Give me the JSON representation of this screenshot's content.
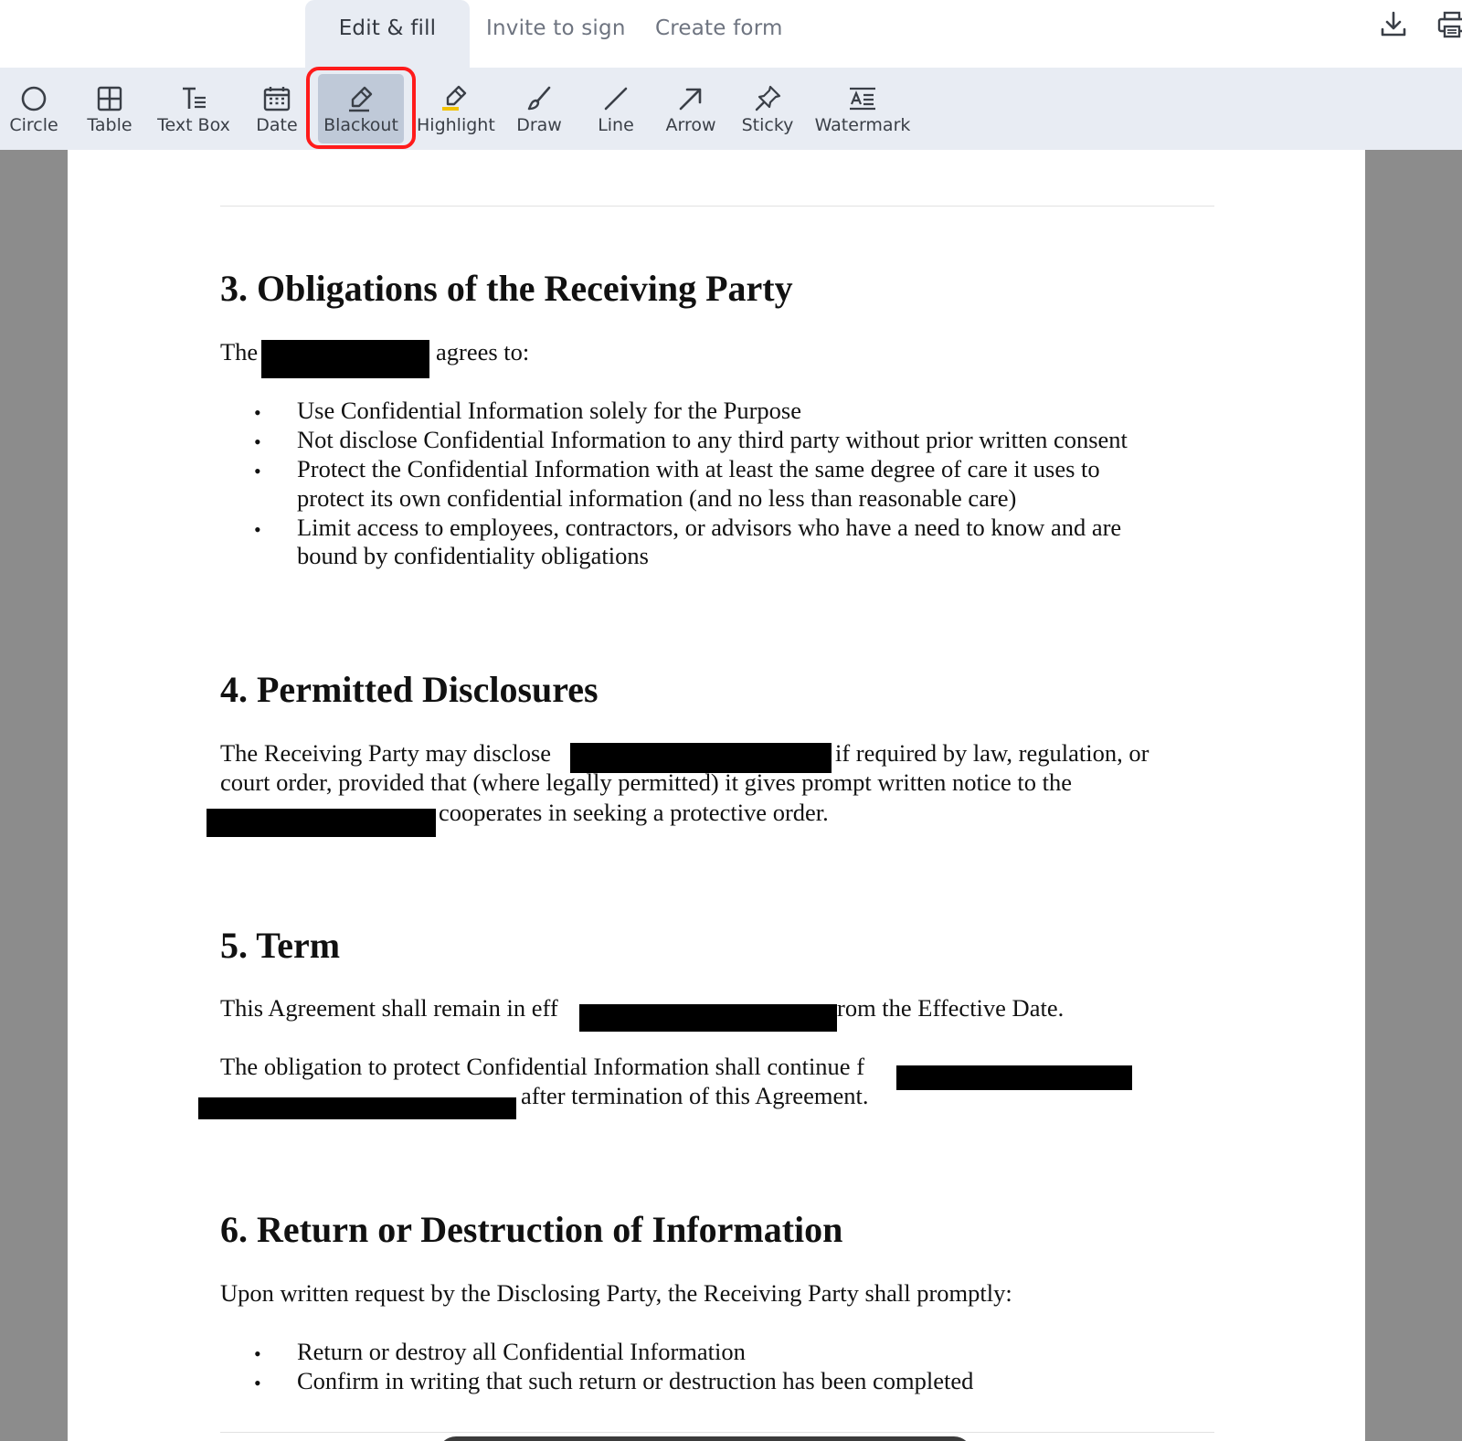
{
  "tabs": [
    {
      "label": "Edit & fill",
      "active": true
    },
    {
      "label": "Invite to sign",
      "active": false
    },
    {
      "label": "Create form",
      "active": false
    }
  ],
  "top_actions": {
    "download_icon": "download-icon",
    "print_icon": "print-icon"
  },
  "toolbar": {
    "tools": [
      {
        "label": "Circle",
        "icon": "circle-icon"
      },
      {
        "label": "Table",
        "icon": "table-icon"
      },
      {
        "label": "Text Box",
        "icon": "text-box-icon"
      },
      {
        "label": "Date",
        "icon": "calendar-icon"
      },
      {
        "label": "Blackout",
        "icon": "blackout-marker-icon",
        "selected": true
      },
      {
        "label": "Highlight",
        "icon": "highlighter-icon"
      },
      {
        "label": "Draw",
        "icon": "brush-icon"
      },
      {
        "label": "Line",
        "icon": "line-icon"
      },
      {
        "label": "Arrow",
        "icon": "arrow-icon"
      },
      {
        "label": "Sticky",
        "icon": "pin-icon"
      },
      {
        "label": "Watermark",
        "icon": "watermark-icon"
      }
    ]
  },
  "document": {
    "s3": {
      "heading": "3. Obligations of the Receiving Party",
      "intro_before": "The",
      "intro_after": "agrees to:",
      "bullets": [
        "Use Confidential Information solely for the Purpose",
        "Not disclose Confidential Information to any third party without prior written consent",
        "Protect the Confidential Information with at least the same degree of care it uses to",
        "protect its own confidential information (and no less than reasonable care)",
        "Limit access to employees, contractors, or advisors who have a need to know and are",
        "bound by confidentiality obligations"
      ]
    },
    "s4": {
      "heading": "4. Permitted Disclosures",
      "line1_before": "The Receiving Party may disclose",
      "line1_after": "if required by law, regulation, or",
      "line2": "court order, provided that (where legally permitted) it gives prompt written notice to the",
      "line3_after": "cooperates in seeking a protective order."
    },
    "s5": {
      "heading": "5. Term",
      "p1_before": "This Agreement shall remain in eff",
      "p1_after": "rom the Effective Date.",
      "p2_before": "The obligation to protect Confidential Information shall continue f",
      "p2_after": "after termination of this Agreement."
    },
    "s6": {
      "heading": "6. Return or Destruction of Information",
      "intro": "Upon written request by the Disclosing Party, the Receiving Party shall promptly:",
      "bullets": [
        "Return or destroy all Confidential Information",
        "Confirm in writing that such return or destruction has been completed"
      ]
    }
  },
  "colors": {
    "toolbar_bg": "#e8ecf3",
    "selected_tool_bg": "#bfc9d8",
    "focus_ring": "#ff1b1b",
    "viewer_bg": "#8c8c8c",
    "redaction": "#000000"
  }
}
